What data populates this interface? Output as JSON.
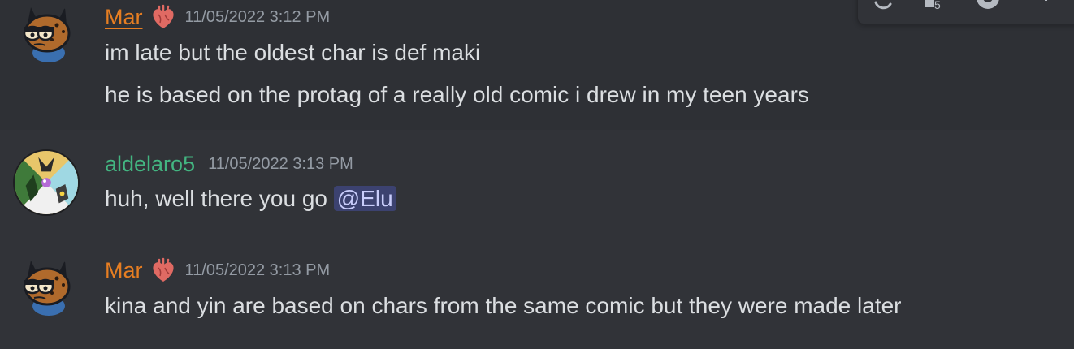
{
  "colors": {
    "background": "#313338",
    "hover_background": "#2e3035",
    "text": "#dbdee1",
    "timestamp": "#949ba4",
    "mar_name": "#e67e22",
    "aldelaro_name": "#43b581",
    "mention_bg": "#3c4270",
    "mention_text": "#c9cdfb"
  },
  "messages": [
    {
      "username": "Mar",
      "role_icon": "anatomical-heart-icon",
      "timestamp": "11/05/2022 3:12 PM",
      "lines": [
        "im late but the oldest char is def maki",
        "he is based on the protag of a really old comic i drew in my teen years"
      ]
    },
    {
      "username": "aldelaro5",
      "timestamp": "11/05/2022 3:13 PM",
      "text": "huh, well there you go",
      "mention": "@Elu"
    },
    {
      "username": "Mar",
      "role_icon": "anatomical-heart-icon",
      "timestamp": "11/05/2022 3:13 PM",
      "lines": [
        "kina and yin are based on chars from the same comic but they were made later"
      ]
    }
  ],
  "toolbar": {
    "icons": [
      "refresh-icon",
      "add-reaction-icon",
      "reply-icon",
      "more-icon"
    ]
  }
}
